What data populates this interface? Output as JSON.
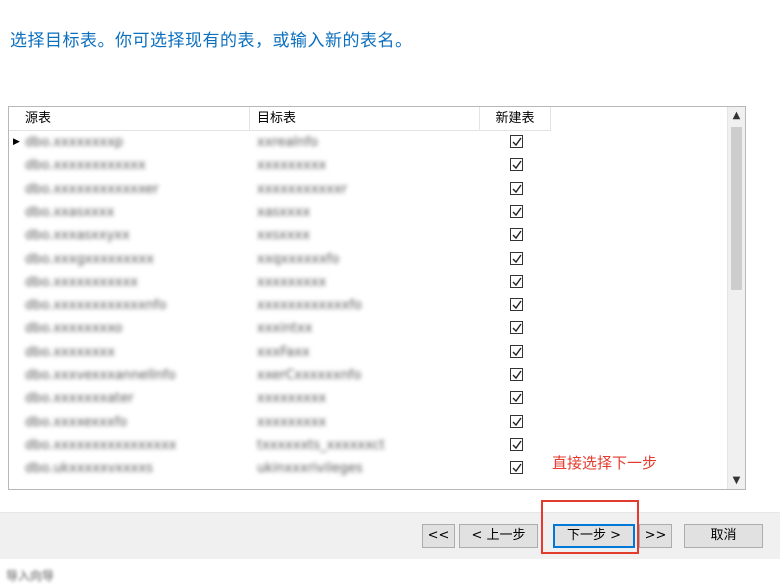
{
  "instruction": "选择目标表。你可选择现有的表，或输入新的表名。",
  "table": {
    "headers": {
      "source": "源表",
      "target": "目标表",
      "create_new": "新建表"
    },
    "rows": [
      {
        "source": "dbo.xxxxxxxxp",
        "target": "xxreaInfo",
        "checked": true,
        "current": true
      },
      {
        "source": "dbo.xxxxxxxxxxxx",
        "target": "xxxxxxxxx",
        "checked": true
      },
      {
        "source": "dbo.xxxxxxxxxxxxer",
        "target": "xxxxxxxxxxxr",
        "checked": true
      },
      {
        "source": "dbo.xxasxxxx",
        "target": "xasxxxx",
        "checked": true
      },
      {
        "source": "dbo.xxxasxxyxx",
        "target": "xxsxxxx",
        "checked": true
      },
      {
        "source": "dbo.xxxgxxxxxxxxx",
        "target": "xxqxxxxxxfo",
        "checked": true
      },
      {
        "source": "dbo.xxxxxxxxxxx",
        "target": "xxxxxxxxx",
        "checked": true
      },
      {
        "source": "dbo.xxxxxxxxxxxxnfo",
        "target": "xxxxxxxxxxxxfo",
        "checked": true
      },
      {
        "source": "dbo.xxxxxxxxo",
        "target": "xxxintxx",
        "checked": true
      },
      {
        "source": "dbo.xxxxxxxx",
        "target": "xxxFaxx",
        "checked": true
      },
      {
        "source": "dbo.xxxvexxxannelInfo",
        "target": "xxerCxxxxxxnfo",
        "checked": true
      },
      {
        "source": "dbo.xxxxxxxater",
        "target": "xxxxxxxxx",
        "checked": true
      },
      {
        "source": "dbo.xxxxexxxfo",
        "target": "xxxxxxxxx",
        "checked": true
      },
      {
        "source": "dbo.xxxxxxxxxxxxxxxx",
        "target": "txxxxxxts_xxxxxxct",
        "checked": true
      },
      {
        "source": "dbo.ukxxxxxvxxxxs",
        "target": "ukinxxxrivileges",
        "checked": true
      }
    ]
  },
  "buttons": {
    "first": "<<",
    "prev": "< 上一步",
    "next": "下一步 >",
    "last": ">>",
    "cancel": "取消"
  },
  "annotation": {
    "text": "直接选择下一步",
    "color": "#e33b2e"
  },
  "taskbar": {
    "item_text": "导入向导"
  },
  "colors": {
    "instruction": "#0b6fbf",
    "focus_border": "#0078d7"
  }
}
